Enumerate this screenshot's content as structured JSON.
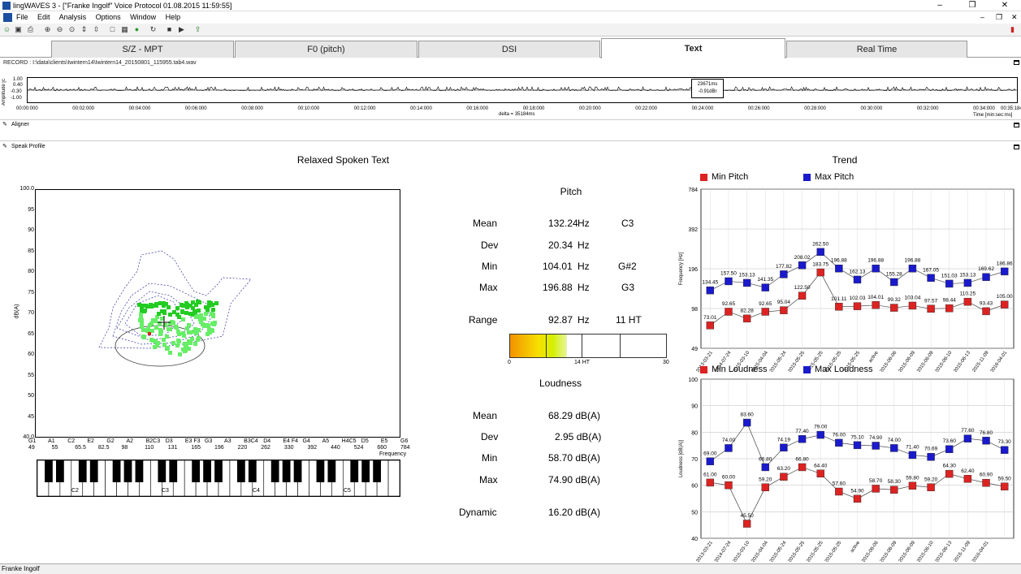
{
  "window": {
    "title": "lingWAVES 3 - [\"Franke Ingolf\" Voice Protocol  01.08.2015 11:59:55]"
  },
  "menu": [
    "File",
    "Edit",
    "Analysis",
    "Options",
    "Window",
    "Help"
  ],
  "tabs": [
    {
      "label": "S/Z - MPT",
      "active": false
    },
    {
      "label": "F0 (pitch)",
      "active": false
    },
    {
      "label": "DSI",
      "active": false
    },
    {
      "label": "Text",
      "active": true
    },
    {
      "label": "Real Time",
      "active": false
    }
  ],
  "record": {
    "label": "RECORD : I:\\data\\clients\\Iwintern14\\Iwintern14_20150801_115955.tab4.wav"
  },
  "waveform": {
    "y_axis_label": "Amplitude [c",
    "y_ticks": [
      "1.00",
      "0.40",
      "-0.30",
      "-1.00"
    ],
    "time_ticks": [
      "00:00:000",
      "00:02:000",
      "00:04:000",
      "00:06:000",
      "00:08:000",
      "00:10:000",
      "00:12:000",
      "00:14:000",
      "00:16:000",
      "00:18:000",
      "00:20:000",
      "00:22:000",
      "00:24:000",
      "00:26:000",
      "00:28:000",
      "00:30:000",
      "00:32:000",
      "00:34:000",
      "00:35:184"
    ],
    "delta": "delta = 35184ms",
    "time_unit": "Time [min:sec:ms]",
    "cursor_time": "23671ms",
    "cursor_value": "-0.91dBr"
  },
  "aligner": {
    "label": "Aligner"
  },
  "speak_profile": {
    "label": "Speak Profile"
  },
  "profile": {
    "title": "Relaxed Spoken Text",
    "y_label": "dB(A)",
    "y_ticks": [
      "100.0",
      "95",
      "90",
      "85",
      "80",
      "75",
      "70",
      "65",
      "60",
      "55",
      "50",
      "45",
      "40.0"
    ],
    "note_labels": [
      "G1",
      "A1",
      "C2",
      "E2",
      "G2",
      "A2",
      "B2C3",
      "D3",
      "E3 F3",
      "G3",
      "A3",
      "B3C4",
      "D4",
      "E4 F4",
      "G4",
      "A5",
      "H4C5",
      "D5",
      "E5",
      "G6"
    ],
    "freq_labels": [
      "49",
      "55",
      "65.5",
      "82.5",
      "98",
      "110",
      "131",
      "165",
      "196",
      "220",
      "262",
      "330",
      "392",
      "440",
      "524",
      "660",
      "784"
    ],
    "x_label": "Frequency",
    "piano_octaves": [
      "C2",
      "C3",
      "C4",
      "C5"
    ]
  },
  "pitch": {
    "heading": "Pitch",
    "rows": [
      {
        "label": "Mean",
        "value": "132.24",
        "unit": "Hz",
        "note": "C3"
      },
      {
        "label": "Dev",
        "value": "20.34",
        "unit": "Hz",
        "note": ""
      },
      {
        "label": "Min",
        "value": "104.01",
        "unit": "Hz",
        "note": "G#2"
      },
      {
        "label": "Max",
        "value": "196.88",
        "unit": "Hz",
        "note": "G3"
      }
    ],
    "range": {
      "label": "Range",
      "value": "92.87",
      "unit": "Hz",
      "ht": "11 HT"
    },
    "range_scale": [
      "0",
      "14 HT",
      "30"
    ]
  },
  "loudness": {
    "heading": "Loudness",
    "rows": [
      {
        "label": "Mean",
        "value": "68.29 dB(A)"
      },
      {
        "label": "Dev",
        "value": "2.95 dB(A)"
      },
      {
        "label": "Min",
        "value": "58.70 dB(A)"
      },
      {
        "label": "Max",
        "value": "74.90 dB(A)"
      }
    ],
    "dynamic": {
      "label": "Dynamic",
      "value": "16.20 dB(A)"
    }
  },
  "trend": {
    "title": "Trend"
  },
  "status": {
    "text": "Franke Ingolf"
  },
  "colors": {
    "min": "#dd2222",
    "max": "#1a1acc",
    "tab_active": "#ffffff",
    "tab": "#e6e6e6"
  },
  "chart_data": [
    {
      "type": "line",
      "ylabel": "Frequency [Hz]",
      "y_ticks": [
        "784",
        "392",
        "196",
        "98",
        "49"
      ],
      "log_scale": true,
      "categories": [
        "2013-03-21",
        "2014-07-24",
        "2015-03-10",
        "2015-04-04",
        "2015-05-24",
        "2015-05-25",
        "2015-05-25",
        "2015-05-25",
        "2015-05-25",
        "active",
        "2015-06-06",
        "2015-06-09",
        "2015-06-09",
        "2015-06-10",
        "2015-06-13",
        "2015-11-09",
        "2016-04-01"
      ],
      "series": [
        {
          "name": "Min Pitch",
          "values": [
            73.01,
            92.65,
            82.28,
            92.65,
            95.04,
            122.5,
            183.75,
            101.11,
            102.03,
            104.01,
            99.32,
            103.04,
            97.57,
            98.44,
            110.25,
            93.43,
            105.0
          ]
        },
        {
          "name": "Max Pitch",
          "values": [
            134.45,
            157.5,
            153.13,
            141.35,
            177.82,
            208.02,
            262.5,
            196.88,
            162.13,
            196.88,
            155.28,
            196.88,
            167.05,
            151.03,
            153.13,
            169.62,
            186.86
          ]
        }
      ]
    },
    {
      "type": "line",
      "ylabel": "Loudness [dB(A)]",
      "ylim": [
        40,
        100
      ],
      "y_ticks": [
        "100",
        "90",
        "80",
        "70",
        "60",
        "50",
        "40"
      ],
      "categories": [
        "2013-03-21",
        "2014-07-24",
        "2015-03-10",
        "2015-04-04",
        "2015-05-24",
        "2015-05-25",
        "2015-05-25",
        "2015-05-25",
        "active",
        "2015-06-06",
        "2015-06-09",
        "2015-06-09",
        "2015-06-10",
        "2015-06-13",
        "2015-11-09",
        "2016-04-01"
      ],
      "series": [
        {
          "name": "Min Loudness",
          "values": [
            61.0,
            60.0,
            45.5,
            59.2,
            63.2,
            66.8,
            64.4,
            57.6,
            54.9,
            58.7,
            58.3,
            59.8,
            59.2,
            64.3,
            62.4,
            60.9,
            59.5
          ]
        },
        {
          "name": "Max Loudness",
          "values": [
            69.0,
            74.0,
            83.6,
            66.8,
            74.19,
            77.4,
            79.0,
            76.0,
            75.1,
            74.9,
            74.0,
            71.4,
            70.69,
            73.6,
            77.6,
            76.8,
            73.3
          ]
        }
      ]
    }
  ]
}
